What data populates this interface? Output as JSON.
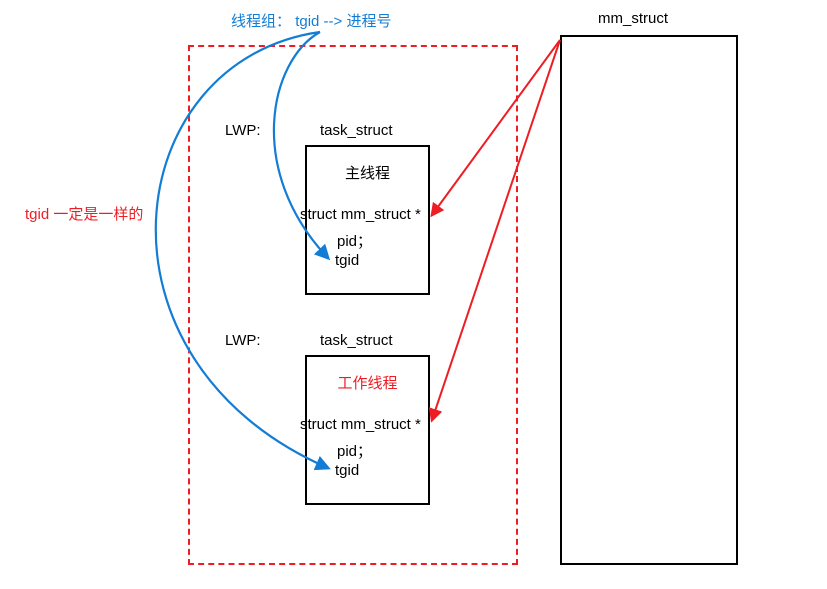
{
  "header": {
    "thread_group_label": "线程组：",
    "tgid_label": "tgid",
    "arrow_text": "-->",
    "process_id_label": "进程号",
    "mm_struct_label": "mm_struct"
  },
  "side_note": "tgid 一定是一样的",
  "task1": {
    "lwp_label": "LWP:",
    "title": "task_struct",
    "role": "主线程",
    "mm_field": "struct mm_struct *",
    "pid_field": "pid；",
    "tgid_field": "tgid"
  },
  "task2": {
    "lwp_label": "LWP:",
    "title": "task_struct",
    "role": "工作线程",
    "mm_field": "struct mm_struct *",
    "pid_field": "pid；",
    "tgid_field": "tgid"
  },
  "colors": {
    "blue": "#137dd5",
    "red": "#ee1d24"
  }
}
